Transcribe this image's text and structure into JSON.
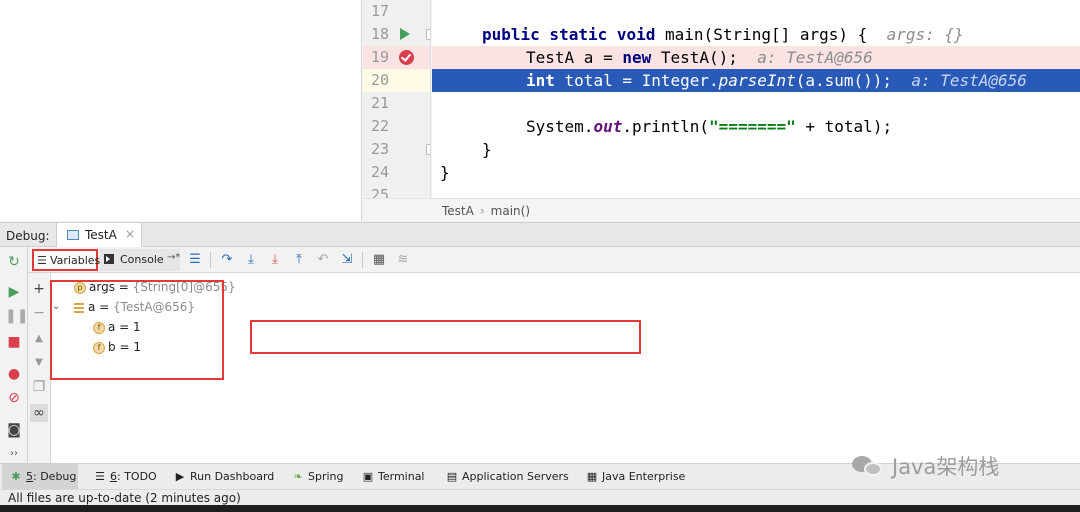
{
  "editor": {
    "lines": [
      {
        "num": "17"
      },
      {
        "num": "18",
        "keywords": "public static void",
        "rest": " main(String[] args) {  ",
        "hint": "args: {}"
      },
      {
        "num": "19",
        "before": "TestA a = ",
        "kw": "new",
        "after": " TestA();  ",
        "hint": "a: TestA@656"
      },
      {
        "num": "20",
        "kw": "int",
        "before": " total = Integer.",
        "italic": "parseInt",
        "after": "(a.sum());  ",
        "hint": "a: TestA@656"
      },
      {
        "num": "21"
      },
      {
        "num": "22",
        "before": "System.",
        "field": "out",
        "middle": ".println(",
        "string": "\"=======\"",
        "after": " + total);"
      },
      {
        "num": "23",
        "text": "}"
      },
      {
        "num": "24",
        "text": "}"
      },
      {
        "num": "25"
      }
    ],
    "breadcrumb": [
      "TestA",
      "main()"
    ],
    "breadcrumb_sep": "›"
  },
  "debug": {
    "label": "Debug:",
    "session_tab": "TestA",
    "close_glyph": "×",
    "tabs": {
      "variables": "Variables",
      "console": "Console",
      "pin": "→*"
    }
  },
  "variables": [
    {
      "badge": "p",
      "name": "args",
      "value": "{String[0]@655}"
    },
    {
      "name": "a",
      "value": "{TestA@656}",
      "expanded": true
    },
    {
      "badge": "f",
      "name": "a",
      "value": "1"
    },
    {
      "badge": "f",
      "name": "b",
      "value": "1"
    }
  ],
  "tool_windows": [
    {
      "icon": "bug",
      "mnemonic": "5",
      "label": ": Debug",
      "active": true
    },
    {
      "icon": "list",
      "mnemonic": "6",
      "label": ": TODO"
    },
    {
      "icon": "play",
      "label": "Run Dashboard"
    },
    {
      "icon": "leaf",
      "label": "Spring"
    },
    {
      "icon": "terminal",
      "label": "Terminal"
    },
    {
      "icon": "server",
      "label": "Application Servers"
    },
    {
      "icon": "java-ee",
      "label": "Java Enterprise"
    }
  ],
  "status": "All files are up-to-date (2 minutes ago)",
  "watermark": "Java架构栈",
  "colors": {
    "current_line": "#2a5ab8",
    "breakpoint_line": "#fbe3e4",
    "highlight_box": "#e53935"
  }
}
